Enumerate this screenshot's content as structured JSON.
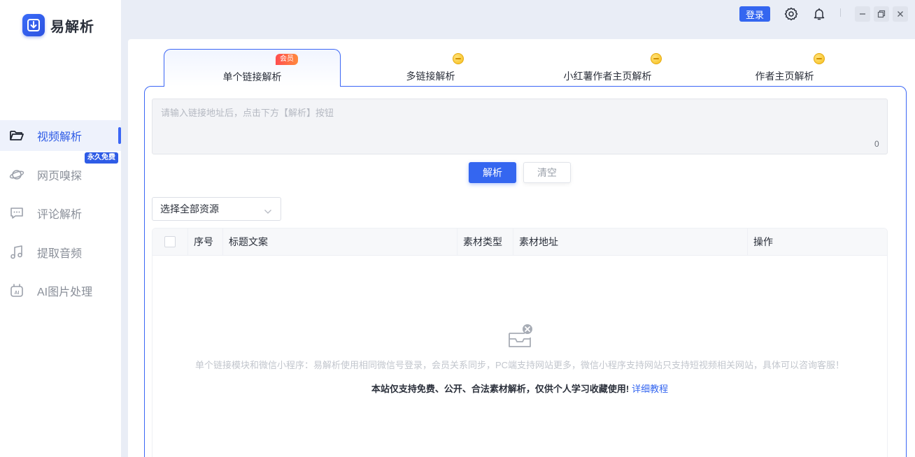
{
  "app": {
    "name": "易解析"
  },
  "sidebar": {
    "items": [
      {
        "label": "视频解析",
        "icon": "folder-open-icon",
        "active": true
      },
      {
        "label": "网页嗅探",
        "icon": "planet-icon",
        "badge": "永久免费"
      },
      {
        "label": "评论解析",
        "icon": "comment-icon"
      },
      {
        "label": "提取音频",
        "icon": "music-note-icon"
      },
      {
        "label": "AI图片处理",
        "icon": "ai-image-icon"
      }
    ]
  },
  "topbar": {
    "login_label": "登录",
    "icons": [
      "gear-icon",
      "bell-icon"
    ],
    "window_controls": [
      "minimize-icon",
      "restore-icon",
      "close-icon"
    ]
  },
  "tabs": [
    {
      "label": "单个链接解析",
      "active": true,
      "tag": "会员"
    },
    {
      "label": "多链接解析",
      "coin": true
    },
    {
      "label": "小红薯作者主页解析",
      "coin": true
    },
    {
      "label": "作者主页解析",
      "coin": true
    }
  ],
  "input": {
    "placeholder": "请输入链接地址后，点击下方【解析】按钮",
    "count": "0"
  },
  "buttons": {
    "parse": "解析",
    "clear": "清空"
  },
  "filter": {
    "selected": "选择全部资源"
  },
  "table": {
    "columns": [
      "序号",
      "标题文案",
      "素材类型",
      "素材地址",
      "操作"
    ],
    "rows": []
  },
  "empty": {
    "tip": "单个链接模块和微信小程序：易解析使用相同微信号登录，会员关系同步，PC端支持网站更多，微信小程序支持网站只支持短视频相关网站，具体可以咨询客服！",
    "notice": "本站仅支持免费、公开、合法素材解析，仅供个人学习收藏使用!",
    "link": "详细教程"
  },
  "colors": {
    "accent": "#3466f0",
    "vip": "#ff4d4f",
    "coin": "#f6bf1c"
  }
}
